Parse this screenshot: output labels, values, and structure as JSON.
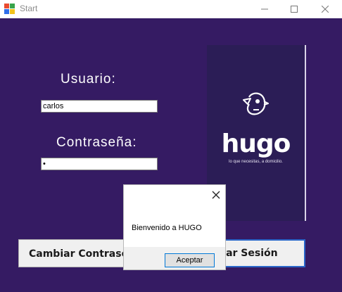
{
  "window": {
    "title": "Start"
  },
  "form": {
    "user_label": "Usuario:",
    "user_value": "carlos",
    "password_label": "Contraseña:",
    "password_value": "•"
  },
  "logo": {
    "brand": "hugo",
    "tagline": "lo que necesitas, a domicilio."
  },
  "buttons": {
    "change_password": "Cambiar Contrase",
    "login": "Iniciar Sesión"
  },
  "dialog": {
    "message": "Bienvenido a HUGO",
    "ok_label": "Aceptar"
  },
  "colors": {
    "background": "#351b63",
    "logo_panel": "#2b1d56",
    "accent": "#0078d7"
  }
}
